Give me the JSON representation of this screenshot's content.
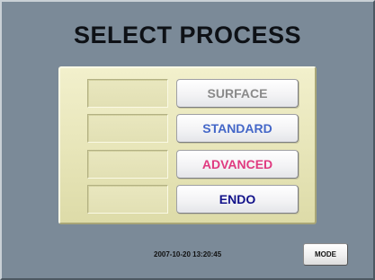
{
  "header": {
    "title": "SELECT PROCESS"
  },
  "processes": [
    {
      "label": "SURFACE",
      "color": "#8a8a8a"
    },
    {
      "label": "STANDARD",
      "color": "#4467c8"
    },
    {
      "label": "ADVANCED",
      "color": "#e03a80"
    },
    {
      "label": "ENDO",
      "color": "#12128a"
    }
  ],
  "footer": {
    "datetime": "2007-10-20 13:20:45",
    "mode_label": "MODE"
  }
}
